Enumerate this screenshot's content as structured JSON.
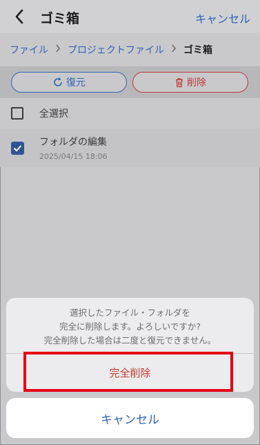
{
  "nav": {
    "title": "ゴミ箱",
    "cancel_label": "キャンセル"
  },
  "breadcrumb": {
    "items": [
      "ファイル",
      "プロジェクトファイル"
    ],
    "current": "ゴミ箱"
  },
  "actions": {
    "restore_label": "復元",
    "delete_label": "削除"
  },
  "list": {
    "select_all_label": "全選択",
    "items": [
      {
        "name": "フォルダの編集",
        "date": "2025/04/15 18:06",
        "checked": true
      }
    ]
  },
  "dialog": {
    "message_line1": "選択したファイル・フォルダを",
    "message_line2": "完全に削除します。よろしいですか?",
    "message_line3": "完全削除した場合は二度と復元できません。",
    "confirm_label": "完全削除",
    "cancel_label": "キャンセル"
  },
  "colors": {
    "accent": "#2f63b4",
    "danger": "#c0392b",
    "highlight": "#e60012"
  }
}
